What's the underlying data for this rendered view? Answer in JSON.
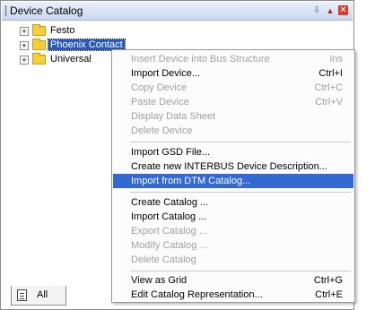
{
  "panel": {
    "title": "Device Catalog",
    "pin_icon": "pin-icon",
    "arrow_icon": "dropdown-arrow-icon",
    "close_icon": "close-icon"
  },
  "tree": {
    "items": [
      {
        "label": "Festo",
        "expander": "+",
        "icon": "folder-icon"
      },
      {
        "label": "Phoenix Contact",
        "expander": "+",
        "icon": "folder-icon",
        "selected": true
      },
      {
        "label": "Universal",
        "expander": "+",
        "icon": "folder-icon"
      }
    ]
  },
  "tabs": {
    "all_label": "All"
  },
  "context_menu": {
    "items": [
      {
        "label": "Insert Device into Bus Structure",
        "shortcut": "Ins",
        "enabled": false
      },
      {
        "label": "Import Device...",
        "shortcut": "Ctrl+I",
        "enabled": true
      },
      {
        "label": "Copy Device",
        "shortcut": "Ctrl+C",
        "enabled": false
      },
      {
        "label": "Paste Device",
        "shortcut": "Ctrl+V",
        "enabled": false
      },
      {
        "label": "Display Data Sheet",
        "shortcut": "",
        "enabled": false
      },
      {
        "label": "Delete Device",
        "shortcut": "",
        "enabled": false
      },
      {
        "label": "Import GSD File...",
        "shortcut": "",
        "enabled": true
      },
      {
        "label": "Create new INTERBUS Device Description...",
        "shortcut": "",
        "enabled": true
      },
      {
        "label": "Import from DTM Catalog...",
        "shortcut": "",
        "enabled": true,
        "highlighted": true
      },
      {
        "label": "Create Catalog ...",
        "shortcut": "",
        "enabled": true
      },
      {
        "label": "Import Catalog ...",
        "shortcut": "",
        "enabled": true
      },
      {
        "label": "Export Catalog ...",
        "shortcut": "",
        "enabled": false
      },
      {
        "label": "Modify Catalog ...",
        "shortcut": "",
        "enabled": false
      },
      {
        "label": "Delete Catalog",
        "shortcut": "",
        "enabled": false
      },
      {
        "label": "View as Grid",
        "shortcut": "Ctrl+G",
        "enabled": true
      },
      {
        "label": "Edit Catalog Representation...",
        "shortcut": "Ctrl+E",
        "enabled": true
      }
    ]
  },
  "colors": {
    "highlight": "#3369d0",
    "selection": "#2a5ab9",
    "disabled_text": "#a0a0a0"
  }
}
